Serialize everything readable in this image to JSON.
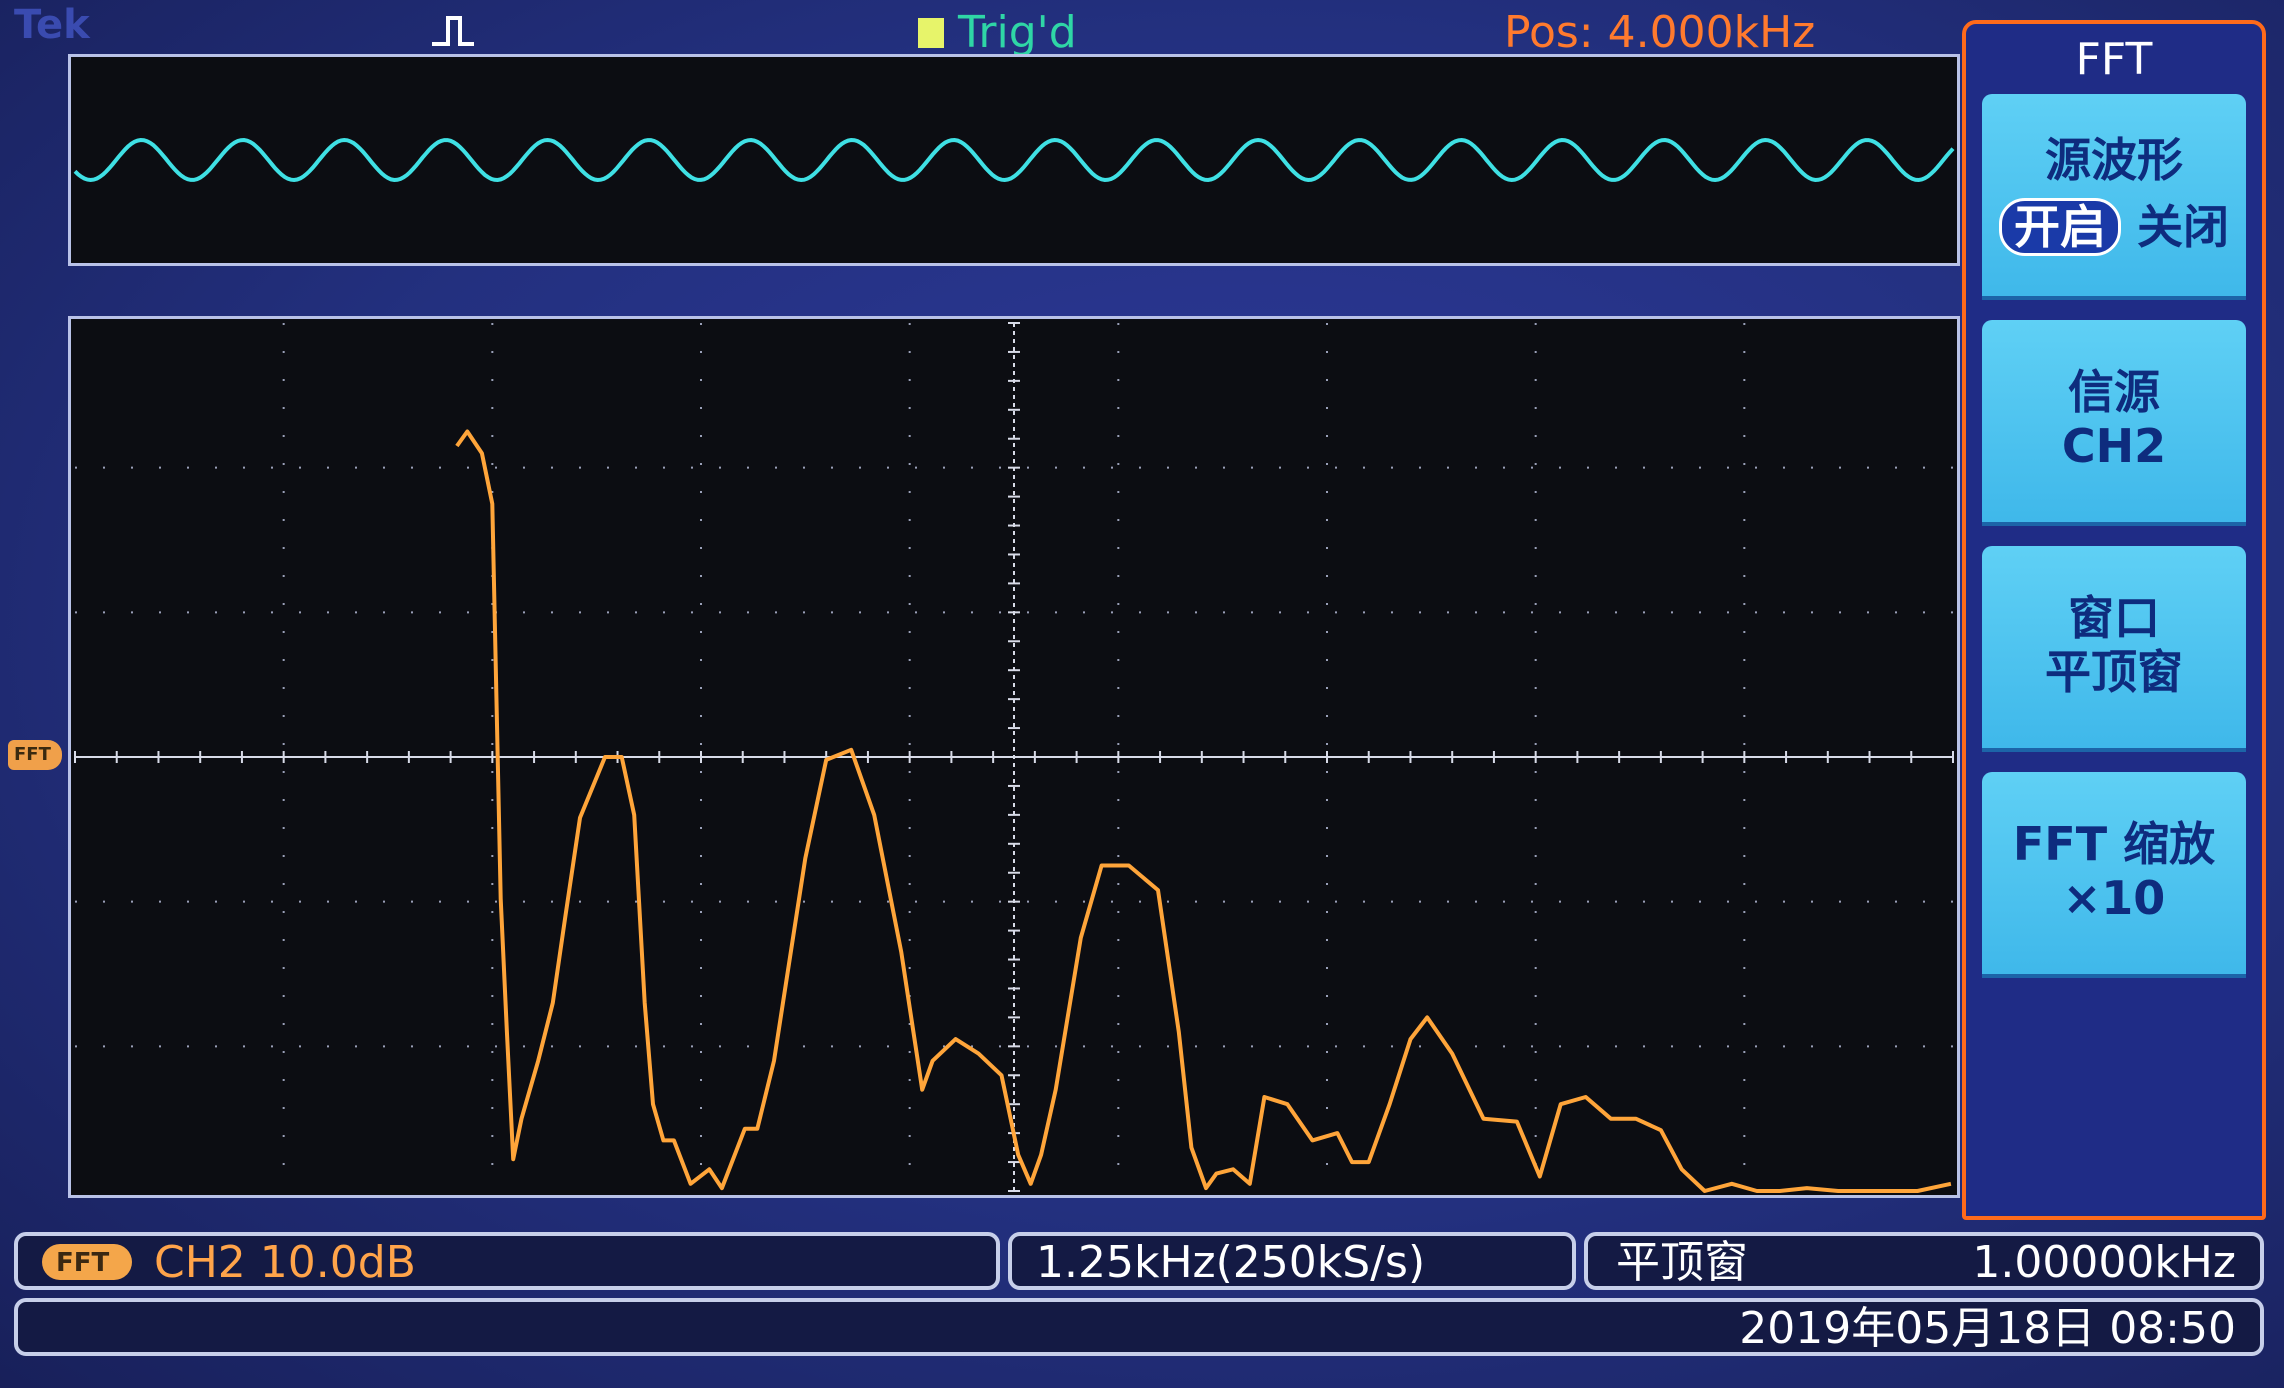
{
  "header": {
    "brand": "Tek",
    "trigger_status": "Trig'd",
    "position": "Pos: 4.000kHz"
  },
  "side_menu": {
    "title": "FFT",
    "buttons": [
      {
        "label": "源波形",
        "options": [
          "开启",
          "关闭"
        ],
        "selected": "开启"
      },
      {
        "label": "信源",
        "value": "CH2"
      },
      {
        "label": "窗口",
        "value": "平顶窗"
      },
      {
        "label": "FFT 缩放",
        "value": "×10"
      }
    ]
  },
  "ref_marker": "FFT",
  "status": {
    "badge": "FFT",
    "channel_scale": "CH2  10.0dB",
    "timebase": "1.25kHz(250kS/s)",
    "window": "平顶窗",
    "freq": "1.00000kHz",
    "datetime": "2019年05月18日 08:50"
  },
  "colors": {
    "fft_trace": "#ffa53a",
    "source_trace": "#3fe0e4",
    "trigger_text": "#2fd6a6",
    "position_text": "#ff7a2e",
    "menu_border": "#ff6a1a",
    "menu_button": "#4fc4f0"
  },
  "chart_data": {
    "type": "line",
    "x_divisions": 9,
    "y_divisions": 6,
    "source_waveform": {
      "type": "sine",
      "cycles": 18.5
    },
    "series": [
      {
        "name": "CH2",
        "x": [
          1.83,
          1.88,
          1.95,
          2.0,
          2.04,
          2.07,
          2.1,
          2.14,
          2.22,
          2.29,
          2.35,
          2.42,
          2.54,
          2.62,
          2.68,
          2.73,
          2.77,
          2.82,
          2.87,
          2.95,
          3.04,
          3.1,
          3.21,
          3.27,
          3.35,
          3.5,
          3.6,
          3.72,
          3.83,
          3.96,
          4.06,
          4.11,
          4.22,
          4.33,
          4.44,
          4.52,
          4.58,
          4.63,
          4.7,
          4.82,
          4.92,
          5.05,
          5.19,
          5.29,
          5.35,
          5.42,
          5.47,
          5.55,
          5.63,
          5.7,
          5.81,
          5.93,
          6.05,
          6.12,
          6.2,
          6.3,
          6.4,
          6.48,
          6.6,
          6.75,
          6.91,
          7.02,
          7.12,
          7.24,
          7.36,
          7.48,
          7.6,
          7.7,
          7.81,
          7.94,
          8.06,
          8.17,
          8.3,
          8.45,
          8.61,
          8.72,
          8.83,
          8.99
        ],
        "y": [
          5.15,
          5.25,
          5.1,
          4.75,
          2.02,
          1.1,
          0.22,
          0.5,
          0.9,
          1.3,
          1.9,
          2.58,
          3.0,
          3.0,
          2.6,
          1.3,
          0.6,
          0.35,
          0.35,
          0.05,
          0.15,
          0.02,
          0.43,
          0.43,
          0.9,
          2.3,
          2.98,
          3.05,
          2.6,
          1.65,
          0.7,
          0.9,
          1.05,
          0.95,
          0.8,
          0.25,
          0.05,
          0.25,
          0.7,
          1.75,
          2.25,
          2.25,
          2.08,
          1.1,
          0.3,
          0.02,
          0.12,
          0.15,
          0.05,
          0.65,
          0.6,
          0.35,
          0.4,
          0.2,
          0.2,
          0.6,
          1.05,
          1.2,
          0.95,
          0.5,
          0.48,
          0.1,
          0.6,
          0.65,
          0.5,
          0.5,
          0.42,
          0.15,
          0.0,
          0.05,
          0.0,
          0.0,
          0.02,
          0.0,
          0.0,
          0.0,
          0.0,
          0.05
        ]
      }
    ]
  }
}
